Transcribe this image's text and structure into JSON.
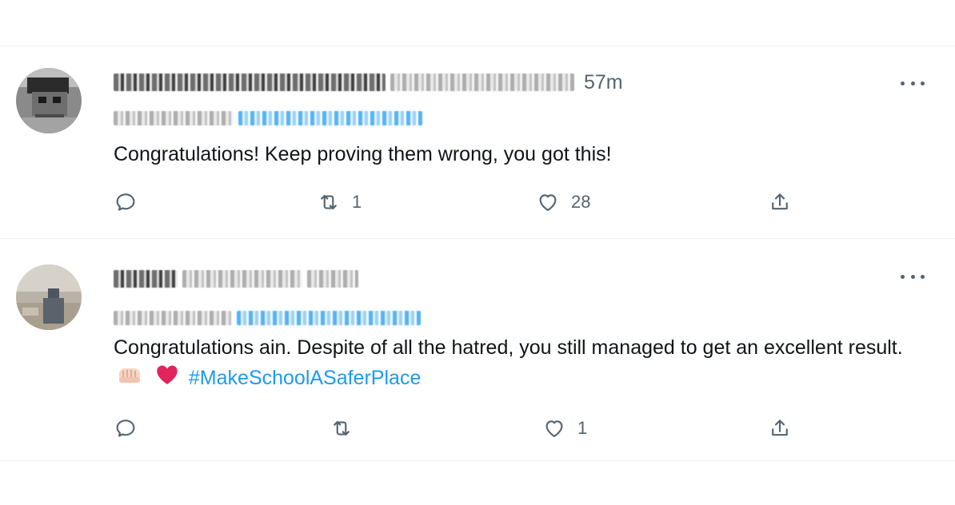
{
  "colors": {
    "accent": "#1d9bf0",
    "text": "#0f1419",
    "muted": "#536471",
    "divider": "#eff3f4",
    "heart": "#e0245e"
  },
  "tweets": [
    {
      "time": "57m",
      "text": "Congratulations! Keep proving them wrong, you got this!",
      "hashtag": "",
      "emojis": [],
      "actions": {
        "reply_count": "",
        "retweet_count": "1",
        "like_count": "28"
      }
    },
    {
      "time": "",
      "text": "Congratulations ain. Despite of all the hatred, you still managed to get an excellent result.",
      "hashtag": "#MakeSchoolASaferPlace",
      "emojis": [
        "oncoming-fist-emoji",
        "red-heart-emoji"
      ],
      "actions": {
        "reply_count": "",
        "retweet_count": "",
        "like_count": "1"
      }
    }
  ],
  "icons": {
    "reply": "reply-icon",
    "retweet": "retweet-icon",
    "like": "heart-icon",
    "share": "share-icon",
    "more": "more-icon"
  }
}
